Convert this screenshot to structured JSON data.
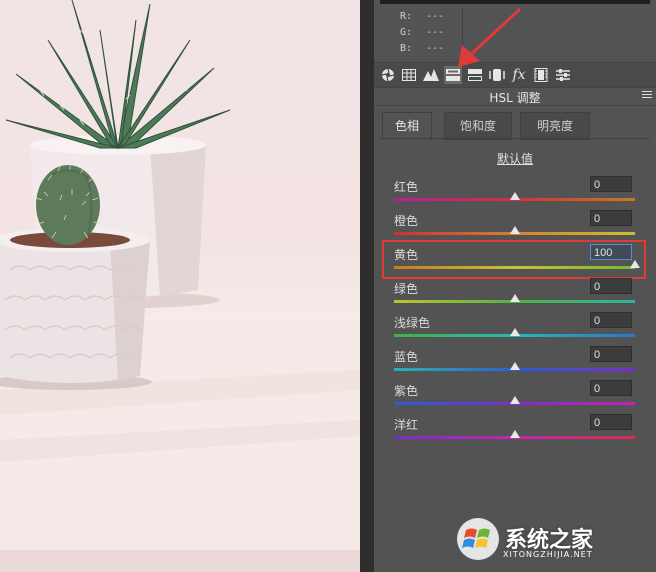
{
  "panel": {
    "rgb": [
      {
        "label": "R:",
        "value": "---"
      },
      {
        "label": "G:",
        "value": "---"
      },
      {
        "label": "B:",
        "value": "---"
      }
    ],
    "title": "HSL 调整",
    "tabs": [
      "色相",
      "饱和度",
      "明亮度"
    ],
    "active_tab": "色相",
    "default_link": "默认值",
    "sliders": [
      {
        "label": "红色",
        "value": "0",
        "fraction": 0.5
      },
      {
        "label": "橙色",
        "value": "0",
        "fraction": 0.5
      },
      {
        "label": "黄色",
        "value": "100",
        "fraction": 1.0
      },
      {
        "label": "绿色",
        "value": "0",
        "fraction": 0.5
      },
      {
        "label": "浅绿色",
        "value": "0",
        "fraction": 0.5
      },
      {
        "label": "蓝色",
        "value": "0",
        "fraction": 0.5
      },
      {
        "label": "紫色",
        "value": "0",
        "fraction": 0.5
      },
      {
        "label": "洋红",
        "value": "0",
        "fraction": 0.5
      }
    ],
    "toolbar_icons": [
      "aperture-icon",
      "grid-icon",
      "mountains-icon",
      "hsl-icon",
      "split-toning-icon",
      "lens-icon",
      "fx-icon",
      "film-icon",
      "sliders-icon"
    ],
    "active_tool": "hsl-icon"
  },
  "watermark": {
    "text": "系统之家",
    "subtext": "XITONGZHIJIA.NET"
  },
  "colors": {
    "highlight": "#e03a3a",
    "arrow": "#e03a3a",
    "panel_bg": "#535353"
  }
}
